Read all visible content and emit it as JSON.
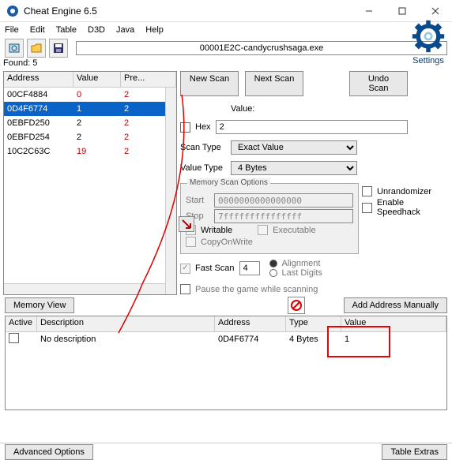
{
  "window": {
    "title": "Cheat Engine 6.5",
    "min": "—",
    "max": "□",
    "close": "✕"
  },
  "menu": [
    "File",
    "Edit",
    "Table",
    "D3D",
    "Java",
    "Help"
  ],
  "exe_label": "00001E2C-candycrushsaga.exe",
  "found_label": "Found: 5",
  "grid": {
    "headers": [
      "Address",
      "Value",
      "Pre..."
    ],
    "rows": [
      {
        "addr": "00CF4884",
        "val": "0",
        "pre": "2",
        "red": true,
        "sel": false
      },
      {
        "addr": "0D4F6774",
        "val": "1",
        "pre": "2",
        "red": false,
        "sel": true
      },
      {
        "addr": "0EBFD250",
        "val": "2",
        "pre": "2",
        "red": false,
        "sel": false
      },
      {
        "addr": "0EBFD254",
        "val": "2",
        "pre": "2",
        "red": false,
        "sel": false
      },
      {
        "addr": "10C2C63C",
        "val": "19",
        "pre": "2",
        "red": true,
        "sel": false
      }
    ]
  },
  "scan": {
    "new": "New Scan",
    "next": "Next Scan",
    "undo": "Undo Scan",
    "settings": "Settings",
    "value_lbl": "Value:",
    "hex_lbl": "Hex",
    "value": "2",
    "scantype_lbl": "Scan Type",
    "scantype": "Exact Value",
    "valuetype_lbl": "Value Type",
    "valuetype": "4 Bytes",
    "mso_legend": "Memory Scan Options",
    "start_lbl": "Start",
    "start": "0000000000000000",
    "stop_lbl": "Stop",
    "stop": "7fffffffffffffff",
    "writable": "Writable",
    "exec": "Executable",
    "cow": "CopyOnWrite",
    "unrandom": "Unrandomizer",
    "speedhack": "Enable Speedhack",
    "fastscan": "Fast Scan",
    "fastscan_val": "4",
    "alignment": "Alignment",
    "lastdigits": "Last Digits",
    "pause": "Pause the game while scanning"
  },
  "memview": "Memory View",
  "addman": "Add Address Manually",
  "cheat": {
    "headers": [
      "Active",
      "Description",
      "Address",
      "Type",
      "Value"
    ],
    "rows": [
      {
        "active": false,
        "desc": "No description",
        "addr": "0D4F6774",
        "type": "4 Bytes",
        "value": "1"
      }
    ]
  },
  "adv": "Advanced Options",
  "extras": "Table Extras"
}
